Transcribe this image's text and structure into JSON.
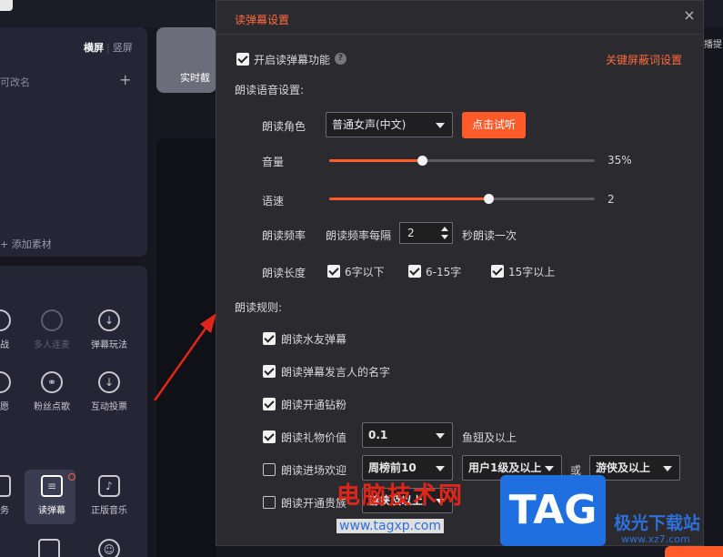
{
  "background": {
    "tabs": {
      "landscape": "横屏",
      "portrait": "竖屏"
    },
    "rename_hint": "可改名",
    "plus": "+",
    "add_material": "+ 添加素材",
    "card_label": "实时截",
    "right_edge_text": "播提",
    "tools": [
      {
        "label": "挑战",
        "icon": "shield-icon"
      },
      {
        "label": "多人连麦",
        "icon": "mic-link-icon"
      },
      {
        "label": "弹幕玩法",
        "icon": "download-icon"
      },
      {
        "label": "心愿",
        "icon": "heart-icon"
      },
      {
        "label": "粉丝点歌",
        "icon": "link-icon"
      },
      {
        "label": "互动投票",
        "icon": "download-icon"
      },
      {
        "label": "任务",
        "icon": "task-icon"
      },
      {
        "label": "读弹幕",
        "icon": "read-danmaku-icon"
      },
      {
        "label": "正版音乐",
        "icon": "music-icon"
      }
    ]
  },
  "dialog": {
    "title": "读弹幕设置",
    "close": "×",
    "enable_label": "开启读弹幕功能",
    "help": "?",
    "keyword_link": "关键屏蔽词设置",
    "voice_section": "朗读语音设置:",
    "role_label": "朗读角色",
    "role_value": "普通女声(中文)",
    "try_button": "点击试听",
    "volume_label": "音量",
    "volume_value": "35%",
    "volume_level": 0.35,
    "speed_label": "语速",
    "speed_value": "2",
    "speed_level": 0.6,
    "freq_label": "朗读频率",
    "freq_prefix": "朗读频率每隔",
    "freq_value": "2",
    "freq_suffix": "秒朗读一次",
    "length_label": "朗读长度",
    "length_options": [
      {
        "label": "6字以下",
        "checked": true
      },
      {
        "label": "6-15字",
        "checked": true
      },
      {
        "label": "15字以上",
        "checked": true
      }
    ],
    "rules_section": "朗读规则:",
    "rules": [
      {
        "label": "朗读水友弹幕",
        "checked": true
      },
      {
        "label": "朗读弹幕发言人的名字",
        "checked": true
      },
      {
        "label": "朗读开通钻粉",
        "checked": true
      },
      {
        "label": "朗读礼物价值",
        "checked": true,
        "select": "0.1",
        "suffix": "鱼翅及以上"
      },
      {
        "label": "朗读进场欢迎",
        "checked": false,
        "select1": "周榜前10",
        "select2": "用户1级及以上",
        "or": "或",
        "select3": "游侠及以上"
      },
      {
        "label": "朗读开通贵族",
        "checked": false,
        "select": "游侠及以上"
      }
    ]
  },
  "watermark": {
    "site_name": "电脑技术网",
    "site_url": "www.tagxp.com",
    "tag": "TAG",
    "jg_name": "极光下载站",
    "jg_url": "www.xz7.com"
  },
  "colors": {
    "accent": "#ff5a2a",
    "title": "#ff6a3d",
    "dialog_bg": "#2b2b2f"
  }
}
